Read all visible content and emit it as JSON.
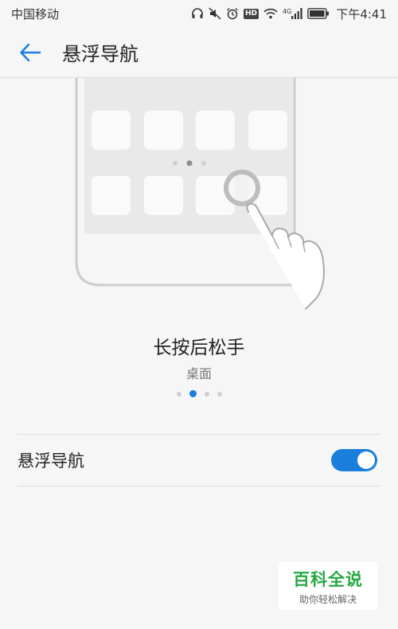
{
  "status_bar": {
    "carrier": "中国移动",
    "network": "4G",
    "hd": "HD",
    "time": "下午4:41"
  },
  "app_bar": {
    "title": "悬浮导航"
  },
  "illustration": {
    "caption_title": "长按后松手",
    "caption_subtitle": "桌面",
    "page_indicator": {
      "count": 4,
      "active_index": 1
    }
  },
  "setting": {
    "label": "悬浮导航",
    "toggle_on": true
  },
  "colors": {
    "accent": "#1a7fdc",
    "watermark_green": "#27a844"
  },
  "watermark": {
    "main": "百科全说",
    "sub": "助你轻松解决"
  }
}
